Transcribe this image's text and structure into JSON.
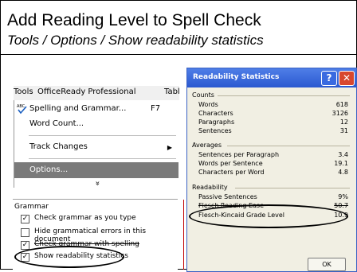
{
  "slide": {
    "title": "Add Reading Level to Spell Check",
    "subtitle": "Tools / Options / Show readability statistics"
  },
  "menubar": {
    "items": [
      {
        "label": "Tools"
      },
      {
        "label": "OfficeReady Professional"
      },
      {
        "label": "Tabl"
      }
    ]
  },
  "tools_menu": {
    "items": [
      {
        "label": "Spelling and Grammar...",
        "shortcut": "F7",
        "icon": "spelling-abc-icon"
      },
      {
        "label": "Word Count..."
      },
      {
        "label": "Track Changes",
        "icon": "submenu-arrow-icon"
      },
      {
        "label": "Options..."
      }
    ],
    "expand_glyph": "»"
  },
  "grammar_panel": {
    "title": "Grammar",
    "options": [
      {
        "label": "Check grammar as you type",
        "checked": true
      },
      {
        "label": "Hide grammatical errors in this document",
        "checked": false
      },
      {
        "label": "Check grammar with spelling",
        "checked": true
      },
      {
        "label": "Show readability statistics",
        "checked": true
      }
    ]
  },
  "readability_dialog": {
    "title": "Readability Statistics",
    "help_glyph": "?",
    "close_glyph": "✕",
    "counts": {
      "heading": "Counts",
      "rows": [
        {
          "label": "Words",
          "value": "618"
        },
        {
          "label": "Characters",
          "value": "3126"
        },
        {
          "label": "Paragraphs",
          "value": "12"
        },
        {
          "label": "Sentences",
          "value": "31"
        }
      ]
    },
    "averages": {
      "heading": "Averages",
      "rows": [
        {
          "label": "Sentences per Paragraph",
          "value": "3.4"
        },
        {
          "label": "Words per Sentence",
          "value": "19.1"
        },
        {
          "label": "Characters per Word",
          "value": "4.8"
        }
      ]
    },
    "readability": {
      "heading": "Readability",
      "rows": [
        {
          "label": "Passive Sentences",
          "value": "9%"
        },
        {
          "label": "Flesch Reading Ease",
          "value": "50.7"
        },
        {
          "label": "Flesch-Kincaid Grade Level",
          "value": "10.9"
        }
      ]
    },
    "ok_label": "OK"
  },
  "colors": {
    "dialog_title": "#2a58d0",
    "dialog_body": "#f1efe3",
    "menu_highlight": "#7a7a7a",
    "close_button": "#d8472e"
  }
}
